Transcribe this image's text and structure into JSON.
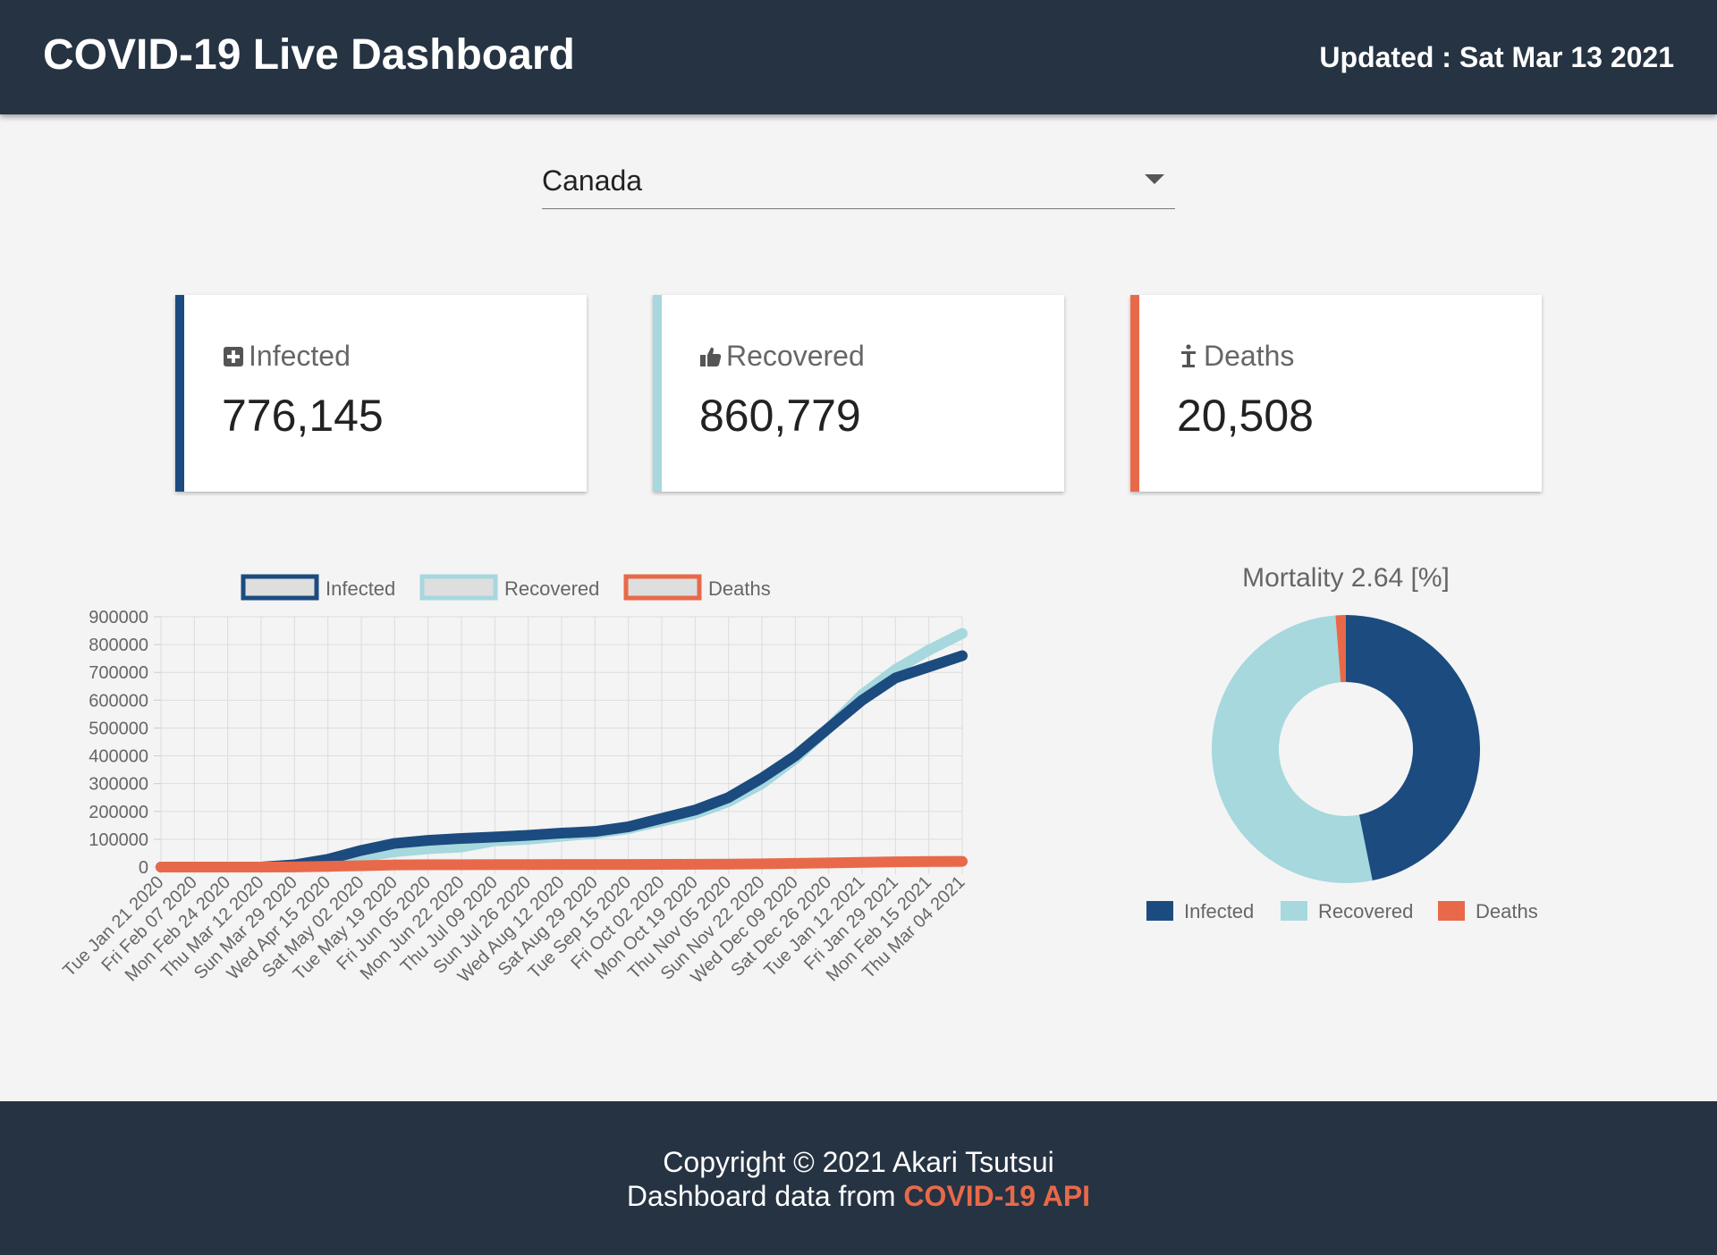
{
  "header": {
    "title": "COVID-19 Live Dashboard",
    "updated": "Updated : Sat Mar 13 2021"
  },
  "country_select": {
    "selected": "Canada"
  },
  "colors": {
    "infected": "#1c4b7f",
    "recovered": "#a6d8de",
    "deaths": "#e8694a",
    "header_bg": "#263342"
  },
  "cards": [
    {
      "label": "Infected",
      "value": "776,145",
      "icon": "medical-cross-icon"
    },
    {
      "label": "Recovered",
      "value": "860,779",
      "icon": "thumbs-up-icon"
    },
    {
      "label": "Deaths",
      "value": "20,508",
      "icon": "cross-grave-icon"
    }
  ],
  "chart_data": [
    {
      "type": "line",
      "legend": [
        "Infected",
        "Recovered",
        "Deaths"
      ],
      "legend_position": "top",
      "grid": true,
      "ylim": [
        0,
        900000
      ],
      "y_ticks": [
        "900000",
        "800000",
        "700000",
        "600000",
        "500000",
        "400000",
        "300000",
        "200000",
        "100000",
        "0"
      ],
      "categories": [
        "Tue Jan 21 2020",
        "Fri Feb 07 2020",
        "Mon Feb 24 2020",
        "Thu Mar 12 2020",
        "Sun Mar 29 2020",
        "Wed Apr 15 2020",
        "Sat May 02 2020",
        "Tue May 19 2020",
        "Fri Jun 05 2020",
        "Mon Jun 22 2020",
        "Thu Jul 09 2020",
        "Sun Jul 26 2020",
        "Wed Aug 12 2020",
        "Sat Aug 29 2020",
        "Tue Sep 15 2020",
        "Fri Oct 02 2020",
        "Mon Oct 19 2020",
        "Thu Nov 05 2020",
        "Sun Nov 22 2020",
        "Wed Dec 09 2020",
        "Sat Dec 26 2020",
        "Tue Jan 12 2021",
        "Fri Jan 29 2021",
        "Mon Feb 15 2021",
        "Thu Mar 04 2021"
      ],
      "series": [
        {
          "name": "Infected",
          "values": [
            0,
            0,
            0,
            0,
            8000,
            28000,
            60000,
            85000,
            96000,
            103000,
            108000,
            114000,
            122000,
            128000,
            145000,
            175000,
            205000,
            250000,
            320000,
            400000,
            500000,
            600000,
            680000,
            720000,
            760000
          ]
        },
        {
          "name": "Recovered",
          "values": [
            0,
            0,
            0,
            0,
            1000,
            10000,
            35000,
            55000,
            66000,
            72000,
            94000,
            100000,
            111000,
            121000,
            138000,
            165000,
            192000,
            235000,
            300000,
            390000,
            500000,
            620000,
            710000,
            780000,
            840000
          ]
        },
        {
          "name": "Deaths",
          "values": [
            0,
            0,
            0,
            0,
            300,
            2500,
            5000,
            7500,
            8300,
            8600,
            8800,
            9000,
            9100,
            9200,
            9300,
            9600,
            10000,
            10500,
            11800,
            13300,
            15000,
            17000,
            19000,
            20000,
            20500
          ]
        }
      ]
    },
    {
      "type": "pie",
      "title": "Mortality 2.64 [%]",
      "legend": [
        "Infected",
        "Recovered",
        "Deaths"
      ],
      "legend_position": "bottom",
      "values": [
        776145,
        860779,
        20508
      ]
    }
  ],
  "footer": {
    "copyright": "Copyright © 2021 Akari Tsutsui",
    "data_prefix": "Dashboard data from ",
    "api_link": "COVID-19 API"
  }
}
